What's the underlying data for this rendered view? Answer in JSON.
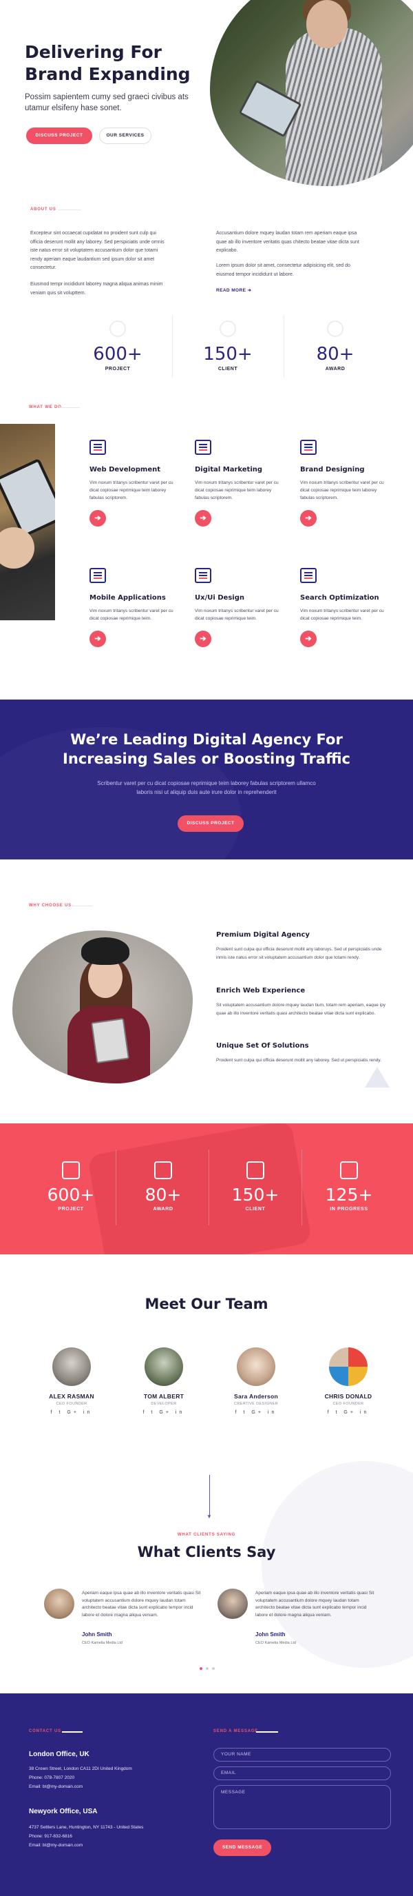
{
  "hero": {
    "title": "Delivering For Brand Expanding",
    "subtitle": "Possim sapientem cumy sed graeci civibus ats utamur elsifeny hase sonet.",
    "primary_button": "DISCUSS PROJECT",
    "secondary_button": "OUR SERVICES"
  },
  "about": {
    "eyebrow": "ABOUT US",
    "left_p1": "Excepteur sint occaecat cupidatat no proident sunt culp qui officia deserunt mollit any laborey. Sed perspiciatis unde omnis iste natus error sit voluptatem accusantium dolor que totami rendy aperiam eaque laudantium sed ipsum dolor sit amet consectetur.",
    "left_p2": "Eiusmod tempr incididunt laborey magna aliqua animas minim veniam quis sit volupttem.",
    "right_p1": "Accusantium dolore mquey laudan totam rem aperiam eaque ipsa quae ab illo inventore veritatis quas chitecto beatae vitae dicta sunt explicabo.",
    "right_p2": "Lorem ipsum dolor sit amet, consectetur adipisicing elit, sed do eiusmod tempor incididunt ut labore.",
    "read_more": "READ MORE"
  },
  "stats": [
    {
      "value": "600+",
      "label": "PROJECT",
      "icon": "globe-icon"
    },
    {
      "value": "150+",
      "label": "CLIENT",
      "icon": "user-icon"
    },
    {
      "value": "80+",
      "label": "AWARD",
      "icon": "trophy-icon"
    }
  ],
  "services": {
    "eyebrow": "WHAT WE DO",
    "items": [
      {
        "title": "Web Development",
        "text": "Vim noxum tritanys scribentur varet per cu dicat copiosae reprimique teim laborey fabulas scriptorem.",
        "icon": "code-icon"
      },
      {
        "title": "Digital Marketing",
        "text": "Vim noxum tritanys scribentur varet per cu dicat copiosae reprimique teim laborey fabulas scriptorem.",
        "icon": "chart-icon"
      },
      {
        "title": "Brand Designing",
        "text": "Vim noxum tritanys scribentur varet per cu dicat copiosae reprimique teim laborey fabulas scriptorem.",
        "icon": "brand-icon"
      },
      {
        "title": "Mobile Applications",
        "text": "Vim noxum tritanys scribentur varet per cu dicat copiosae reprimique teim.",
        "icon": "mobile-icon"
      },
      {
        "title": "Ux/Ui Design",
        "text": "Vim noxum tritanys scribentur varet per cu dicat copiosae reprimique teim.",
        "icon": "design-icon"
      },
      {
        "title": "Search Optimization",
        "text": "Vim noxum tritanys scribentur varet per cu dicat copiosae reprimique teim.",
        "icon": "search-icon"
      }
    ]
  },
  "banner": {
    "title": "We’re Leading Digital Agency For Increasing Sales or Boosting Traffic",
    "subtitle": "Scribentur varet per cu dicat copiosae reprimique teim laborey fabulas scriptorem ullamco laboris nisi ut aliquip duis aute irure dolor in reprehenderit",
    "button": "DISCUSS PROJECT"
  },
  "why": {
    "eyebrow": "WHY CHOOSE US",
    "items": [
      {
        "title": "Premium Digital Agency",
        "text": "Proident sunt culpa qui officia deserunt mollit any laboruys. Sed ut perspiciatis unde inmis iste natus error sit voluptatem accusantium dolor que totami rendy."
      },
      {
        "title": "Enrich Web Experience",
        "text": "Sit voluptatem accusantium dolore mquey laudan tium, totam rem aperiam, eaque ipy quae ab illo inventore veritatis quasi architecto beatae vitae dicta sunt explicabo."
      },
      {
        "title": "Unique Set Of Solutions",
        "text": "Proident sunt culpa qui officia deserunt mollit any laborey. Sed ut perspiciatis rendy."
      }
    ]
  },
  "pink_stats": [
    {
      "value": "600+",
      "label": "PROJECT",
      "icon": "chart-icon"
    },
    {
      "value": "80+",
      "label": "AWARD",
      "icon": "trophy-icon"
    },
    {
      "value": "150+",
      "label": "CLIENT",
      "icon": "user-icon"
    },
    {
      "value": "125+",
      "label": "IN PROGRESS",
      "icon": "progress-icon"
    }
  ],
  "team": {
    "title": "Meet Our Team",
    "members": [
      {
        "name": "ALEX RASMAN",
        "role": "CEO FOUNDER",
        "social": "f  t  G+  in"
      },
      {
        "name": "TOM ALBERT",
        "role": "DEVELOPER",
        "social": "f  t  G+  in"
      },
      {
        "name": "Sara Anderson",
        "role": "CREATIVE DESIGNER",
        "social": "f  t  G+  in"
      },
      {
        "name": "CHRIS DONALD",
        "role": "CEO FOUNDER",
        "social": "f  t  G+  in"
      }
    ]
  },
  "testimonials": {
    "eyebrow": "WHAT CLIENTS SAYING",
    "title": "What Clients Say",
    "items": [
      {
        "text": "Aperiam eaque ipsa quae ab illo inventore veritatis quasi Sit voluptatem accusantium dolore mquey laudan totam architecto beatae vitae dicta sunt explicabo tempor incid labore et dolore magna aliqua veniam.",
        "name": "John Smith",
        "role": "CEO Kamelia Media Ltd"
      },
      {
        "text": "Aperiam eaque ipsa quae ab illo inventore veritatis quasi Sit voluptatem accusantium dolore mquey laudan totam architecto beatae vitae dicta sunt explicabo tempor incid labore et dolore magna aliqua veniam.",
        "name": "John Smith",
        "role": "CEO Kamelia Media Ltd"
      }
    ]
  },
  "footer": {
    "contact_eyebrow": "CONTACT US",
    "office1": {
      "city": "London Office, UK",
      "address": "38 Crown Street, London CA11 2DI United Kingdom",
      "phone": "Phone: 078-7807 2020",
      "email": "Email: bt@my-domain.com"
    },
    "office2": {
      "city": "Newyork Office, USA",
      "address": "4737 Settlers Lane, Huntington, NY 11743 - United States",
      "phone": "Phone: 917-832-6816",
      "email": "Email: bt@my-domain.com"
    },
    "form_eyebrow": "SEND A MESSAGE",
    "name_placeholder": "YOUR NAME",
    "email_placeholder": "EMAIL",
    "message_placeholder": "MESSAGE",
    "send_button": "SEND MESSAGE"
  },
  "colors": {
    "primary": "#2b2580",
    "accent": "#f05164",
    "dark": "#1e1d3a"
  }
}
